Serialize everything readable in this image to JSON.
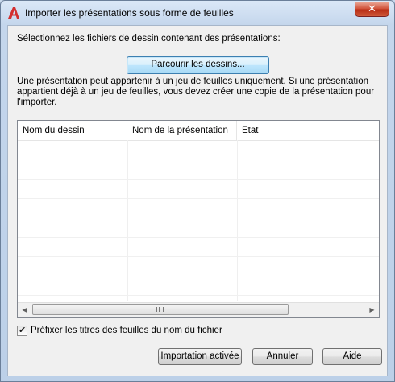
{
  "window": {
    "title": "Importer les présentations sous forme de feuilles"
  },
  "dialog": {
    "select_label": "Sélectionnez les fichiers de dessin contenant des présentations:",
    "browse_button": "Parcourir les dessins...",
    "info_text": "Une présentation peut appartenir à un jeu de feuilles uniquement. Si une présentation appartient déjà à un jeu de feuilles, vous devez créer une copie de la présentation pour l'importer.",
    "columns": [
      "Nom du dessin",
      "Nom de la présentation",
      "Etat"
    ],
    "rows": [],
    "prefix_checkbox": {
      "label": "Préfixer les titres des feuilles du nom du fichier",
      "checked": true
    },
    "buttons": {
      "import": "Importation activée",
      "cancel": "Annuler",
      "help": "Aide"
    }
  },
  "icons": {
    "app": "autocad-icon",
    "close": "close-icon"
  },
  "colors": {
    "app_icon_red": "#d32f2f",
    "close_button_red": "#c7402a"
  }
}
